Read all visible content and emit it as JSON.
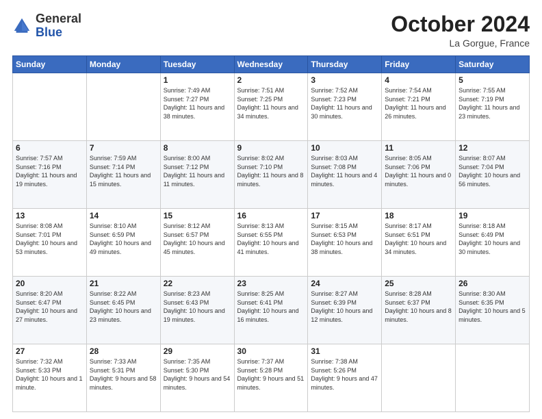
{
  "header": {
    "logo_line1": "General",
    "logo_line2": "Blue",
    "month_title": "October 2024",
    "location": "La Gorgue, France"
  },
  "days_of_week": [
    "Sunday",
    "Monday",
    "Tuesday",
    "Wednesday",
    "Thursday",
    "Friday",
    "Saturday"
  ],
  "weeks": [
    [
      {
        "day": "",
        "info": ""
      },
      {
        "day": "",
        "info": ""
      },
      {
        "day": "1",
        "info": "Sunrise: 7:49 AM\nSunset: 7:27 PM\nDaylight: 11 hours and 38 minutes."
      },
      {
        "day": "2",
        "info": "Sunrise: 7:51 AM\nSunset: 7:25 PM\nDaylight: 11 hours and 34 minutes."
      },
      {
        "day": "3",
        "info": "Sunrise: 7:52 AM\nSunset: 7:23 PM\nDaylight: 11 hours and 30 minutes."
      },
      {
        "day": "4",
        "info": "Sunrise: 7:54 AM\nSunset: 7:21 PM\nDaylight: 11 hours and 26 minutes."
      },
      {
        "day": "5",
        "info": "Sunrise: 7:55 AM\nSunset: 7:19 PM\nDaylight: 11 hours and 23 minutes."
      }
    ],
    [
      {
        "day": "6",
        "info": "Sunrise: 7:57 AM\nSunset: 7:16 PM\nDaylight: 11 hours and 19 minutes."
      },
      {
        "day": "7",
        "info": "Sunrise: 7:59 AM\nSunset: 7:14 PM\nDaylight: 11 hours and 15 minutes."
      },
      {
        "day": "8",
        "info": "Sunrise: 8:00 AM\nSunset: 7:12 PM\nDaylight: 11 hours and 11 minutes."
      },
      {
        "day": "9",
        "info": "Sunrise: 8:02 AM\nSunset: 7:10 PM\nDaylight: 11 hours and 8 minutes."
      },
      {
        "day": "10",
        "info": "Sunrise: 8:03 AM\nSunset: 7:08 PM\nDaylight: 11 hours and 4 minutes."
      },
      {
        "day": "11",
        "info": "Sunrise: 8:05 AM\nSunset: 7:06 PM\nDaylight: 11 hours and 0 minutes."
      },
      {
        "day": "12",
        "info": "Sunrise: 8:07 AM\nSunset: 7:04 PM\nDaylight: 10 hours and 56 minutes."
      }
    ],
    [
      {
        "day": "13",
        "info": "Sunrise: 8:08 AM\nSunset: 7:01 PM\nDaylight: 10 hours and 53 minutes."
      },
      {
        "day": "14",
        "info": "Sunrise: 8:10 AM\nSunset: 6:59 PM\nDaylight: 10 hours and 49 minutes."
      },
      {
        "day": "15",
        "info": "Sunrise: 8:12 AM\nSunset: 6:57 PM\nDaylight: 10 hours and 45 minutes."
      },
      {
        "day": "16",
        "info": "Sunrise: 8:13 AM\nSunset: 6:55 PM\nDaylight: 10 hours and 41 minutes."
      },
      {
        "day": "17",
        "info": "Sunrise: 8:15 AM\nSunset: 6:53 PM\nDaylight: 10 hours and 38 minutes."
      },
      {
        "day": "18",
        "info": "Sunrise: 8:17 AM\nSunset: 6:51 PM\nDaylight: 10 hours and 34 minutes."
      },
      {
        "day": "19",
        "info": "Sunrise: 8:18 AM\nSunset: 6:49 PM\nDaylight: 10 hours and 30 minutes."
      }
    ],
    [
      {
        "day": "20",
        "info": "Sunrise: 8:20 AM\nSunset: 6:47 PM\nDaylight: 10 hours and 27 minutes."
      },
      {
        "day": "21",
        "info": "Sunrise: 8:22 AM\nSunset: 6:45 PM\nDaylight: 10 hours and 23 minutes."
      },
      {
        "day": "22",
        "info": "Sunrise: 8:23 AM\nSunset: 6:43 PM\nDaylight: 10 hours and 19 minutes."
      },
      {
        "day": "23",
        "info": "Sunrise: 8:25 AM\nSunset: 6:41 PM\nDaylight: 10 hours and 16 minutes."
      },
      {
        "day": "24",
        "info": "Sunrise: 8:27 AM\nSunset: 6:39 PM\nDaylight: 10 hours and 12 minutes."
      },
      {
        "day": "25",
        "info": "Sunrise: 8:28 AM\nSunset: 6:37 PM\nDaylight: 10 hours and 8 minutes."
      },
      {
        "day": "26",
        "info": "Sunrise: 8:30 AM\nSunset: 6:35 PM\nDaylight: 10 hours and 5 minutes."
      }
    ],
    [
      {
        "day": "27",
        "info": "Sunrise: 7:32 AM\nSunset: 5:33 PM\nDaylight: 10 hours and 1 minute."
      },
      {
        "day": "28",
        "info": "Sunrise: 7:33 AM\nSunset: 5:31 PM\nDaylight: 9 hours and 58 minutes."
      },
      {
        "day": "29",
        "info": "Sunrise: 7:35 AM\nSunset: 5:30 PM\nDaylight: 9 hours and 54 minutes."
      },
      {
        "day": "30",
        "info": "Sunrise: 7:37 AM\nSunset: 5:28 PM\nDaylight: 9 hours and 51 minutes."
      },
      {
        "day": "31",
        "info": "Sunrise: 7:38 AM\nSunset: 5:26 PM\nDaylight: 9 hours and 47 minutes."
      },
      {
        "day": "",
        "info": ""
      },
      {
        "day": "",
        "info": ""
      }
    ]
  ]
}
